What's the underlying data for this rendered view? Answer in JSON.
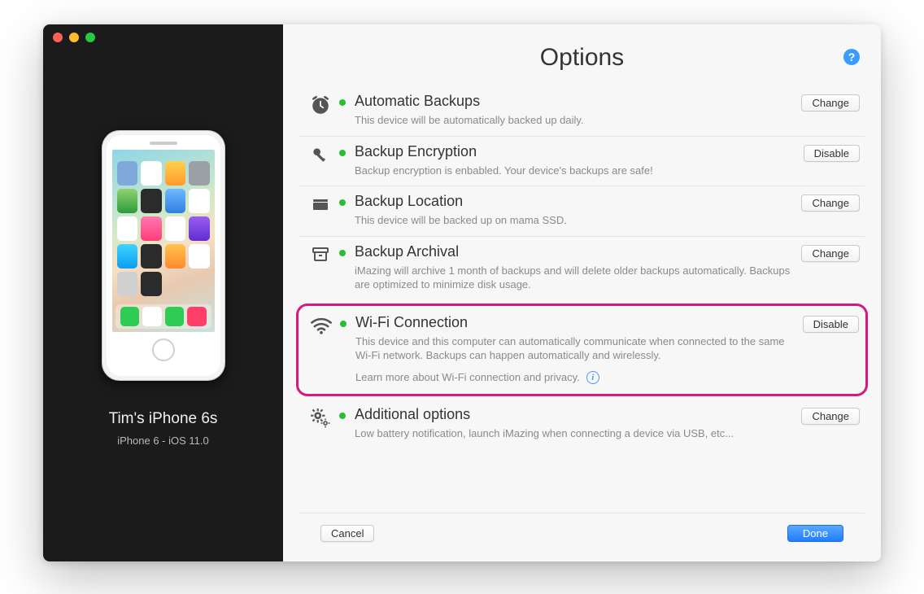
{
  "header": {
    "title": "Options"
  },
  "sidebar": {
    "device_name": "Tim's iPhone 6s",
    "device_sub": "iPhone 6 - iOS 11.0"
  },
  "options": {
    "auto_backup": {
      "title": "Automatic Backups",
      "desc": "This device will be automatically backed up daily.",
      "button": "Change"
    },
    "encryption": {
      "title": "Backup Encryption",
      "desc": "Backup encryption is enbabled. Your device's backups are safe!",
      "button": "Disable"
    },
    "location": {
      "title": "Backup Location",
      "desc": "This device will be backed up on mama SSD.",
      "button": "Change"
    },
    "archival": {
      "title": "Backup Archival",
      "desc": "iMazing will archive 1 month of backups and will delete older backups automatically. Backups are optimized to minimize disk usage.",
      "button": "Change"
    },
    "wifi": {
      "title": "Wi-Fi Connection",
      "desc": "This device and this computer can automatically communicate when connected to the same Wi-Fi network. Backups can happen automatically and wirelessly.",
      "link": "Learn more about Wi-Fi connection and privacy.",
      "button": "Disable"
    },
    "additional": {
      "title": "Additional options",
      "desc": "Low battery notification, launch iMazing when connecting a device via USB, etc...",
      "button": "Change"
    }
  },
  "footer": {
    "cancel": "Cancel",
    "done": "Done"
  },
  "icons": {
    "help": "?",
    "info": "i"
  },
  "colors": {
    "status_ok": "#2bbd35",
    "highlight": "#d4197f",
    "primary": "#1f7dff"
  }
}
